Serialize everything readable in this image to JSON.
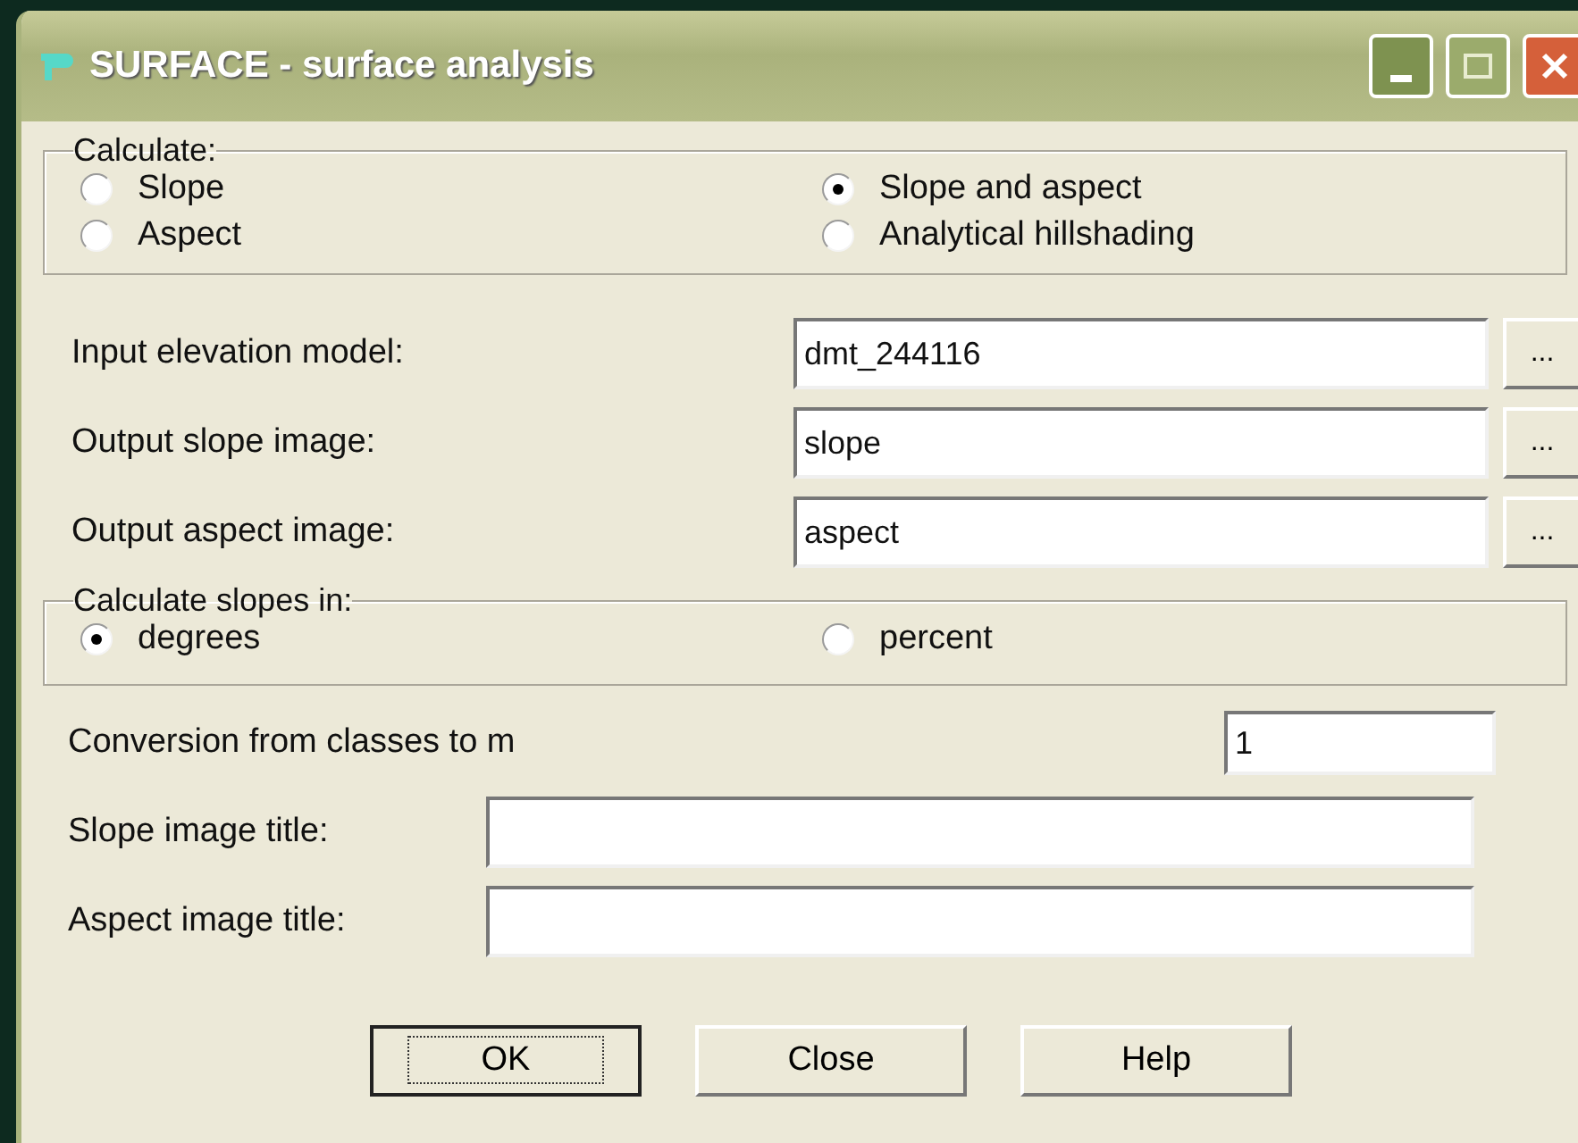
{
  "window": {
    "title": "SURFACE - surface analysis"
  },
  "calculate": {
    "label": "Calculate:",
    "options": [
      {
        "label": "Slope",
        "selected": false
      },
      {
        "label": "Slope and aspect",
        "selected": true
      },
      {
        "label": "Aspect",
        "selected": false
      },
      {
        "label": "Analytical hillshading",
        "selected": false
      }
    ]
  },
  "files": [
    {
      "label": "Input elevation model:",
      "value": "dmt_244116",
      "browse": "..."
    },
    {
      "label": "Output slope image:",
      "value": "slope",
      "browse": "..."
    },
    {
      "label": "Output aspect image:",
      "value": "aspect",
      "browse": "..."
    }
  ],
  "units": {
    "label": "Calculate slopes in:",
    "options": [
      {
        "label": "degrees",
        "selected": true
      },
      {
        "label": "percent",
        "selected": false
      }
    ]
  },
  "conversion": {
    "label": "Conversion from classes to m",
    "value": "1"
  },
  "titles": [
    {
      "label": "Slope image title:"
    },
    {
      "label": "Aspect image title:"
    }
  ],
  "buttons": [
    {
      "label": "OK",
      "default": true
    },
    {
      "label": "Close",
      "default": false
    },
    {
      "label": "Help",
      "default": false
    }
  ]
}
